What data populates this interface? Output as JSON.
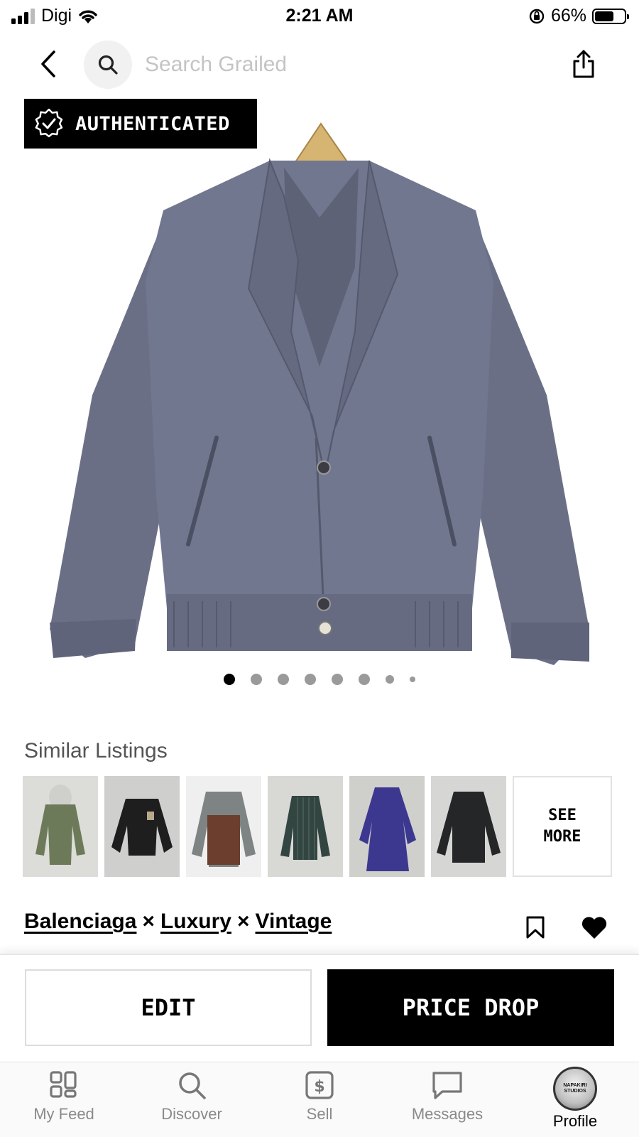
{
  "status_bar": {
    "carrier": "Digi",
    "time": "2:21 AM",
    "battery_percent": "66%",
    "battery_level": 0.66,
    "icons": [
      "signal-icon",
      "wifi-icon",
      "orientation-lock-icon",
      "battery-icon"
    ]
  },
  "nav": {
    "back_icon": "chevron-left-icon",
    "search_placeholder": "Search Grailed",
    "share_icon": "share-icon"
  },
  "product": {
    "badge": "AUTHENTICATED",
    "badge_icon": "verified-check-icon",
    "image_count": 8,
    "active_image_index": 0
  },
  "similar": {
    "title": "Similar Listings",
    "see_more": "SEE\nMORE"
  },
  "listing": {
    "designers": [
      "Balenciaga",
      "Luxury",
      "Vintage"
    ],
    "separator": "×"
  },
  "actions": {
    "edit": "EDIT",
    "price_drop": "PRICE DROP"
  },
  "tabs": [
    {
      "label": "My Feed",
      "icon": "feed-grid-icon"
    },
    {
      "label": "Discover",
      "icon": "search-icon"
    },
    {
      "label": "Sell",
      "icon": "dollar-tag-icon"
    },
    {
      "label": "Messages",
      "icon": "chat-bubble-icon"
    },
    {
      "label": "Profile",
      "icon": "avatar",
      "avatar_text": "NAPAKIRI STUDIOS"
    }
  ],
  "colors": {
    "brand_black": "#000000",
    "placeholder_gray": "#c4c4c4",
    "jacket_color": "#6b6f86"
  }
}
